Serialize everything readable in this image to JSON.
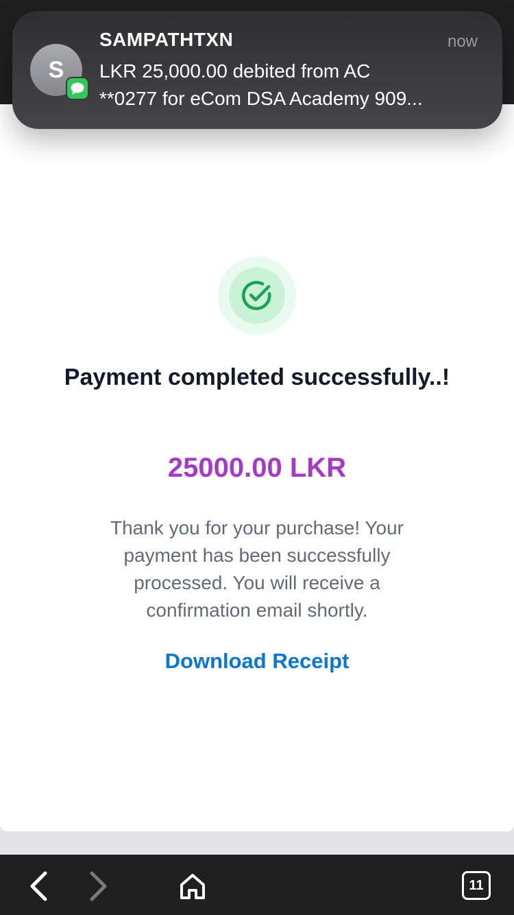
{
  "notification": {
    "sender": "SAMPATHTXN",
    "time": "now",
    "avatar_letter": "S",
    "line1": "LKR 25,000.00 debited from AC",
    "line2": "**0277 for eCom DSA Academy 909...",
    "badge_icon": "messages-icon"
  },
  "payment": {
    "title": "Payment completed successfully..!",
    "amount": "25000.00 LKR",
    "message": "Thank you for your purchase! Your payment has been successfully processed. You will receive a confirmation email shortly.",
    "download_label": "Download Receipt",
    "status_icon": "check-circle-icon"
  },
  "browser_bar": {
    "back_icon": "chevron-left-icon",
    "forward_icon": "chevron-right-icon",
    "home_icon": "home-icon",
    "tabs_count": "11"
  },
  "colors": {
    "amount": "#a739c9",
    "link": "#0a77d6",
    "success": "#1aa356"
  }
}
